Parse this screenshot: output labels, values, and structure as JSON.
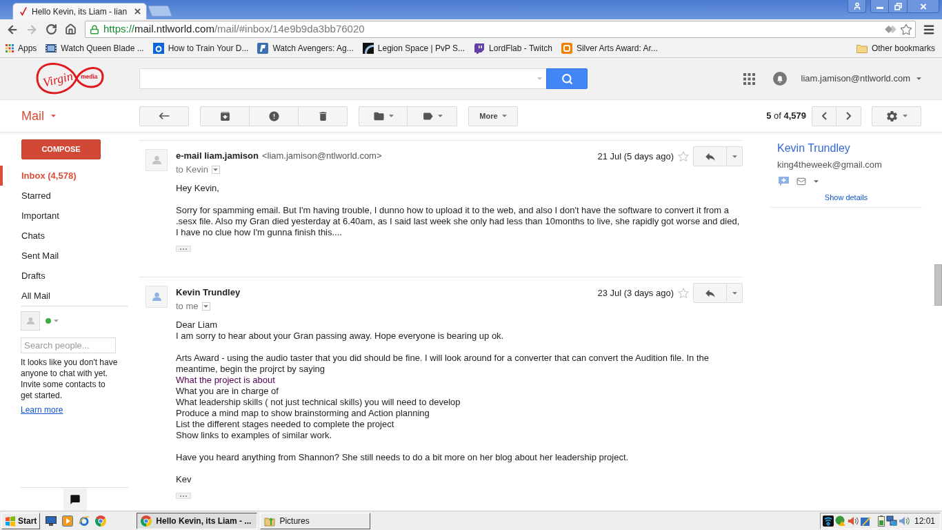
{
  "browser": {
    "tabs": [
      {
        "title": "Hello Kevin, its Liam - lian",
        "selected": true
      }
    ],
    "back": {
      "disabled": false
    },
    "forward": {
      "disabled": true
    },
    "address": {
      "secure": true,
      "scheme": "https://",
      "host": "mail.ntlworld.com",
      "path": "/mail/#inbox/14e9b9da3bb76020"
    },
    "bookmarks": [
      {
        "label": "Apps"
      },
      {
        "label": "Watch Queen Blade ..."
      },
      {
        "label": "How to Train Your D..."
      },
      {
        "label": "Watch Avengers: Ag..."
      },
      {
        "label": "Legion Space | PvP S..."
      },
      {
        "label": "LordFlab - Twitch"
      },
      {
        "label": "Silver Arts Award: Ar..."
      }
    ],
    "other_bookmarks": "Other bookmarks"
  },
  "header": {
    "logo": {
      "wordmark": "Virgin",
      "tagline": "media"
    },
    "account": "liam.jamison@ntlworld.com"
  },
  "toolbar": {
    "app": "Mail",
    "more": "More",
    "pager": "**5** of **4,579**"
  },
  "sidebar": {
    "compose": "COMPOSE",
    "folders": [
      {
        "label": "Inbox (4,578)",
        "selected": true
      },
      {
        "label": "Starred",
        "selected": false
      },
      {
        "label": "Important",
        "selected": false
      },
      {
        "label": "Chats",
        "selected": false
      },
      {
        "label": "Sent Mail",
        "selected": false
      },
      {
        "label": "Drafts",
        "selected": false
      },
      {
        "label": "All Mail",
        "selected": false
      }
    ]
  },
  "chat": {
    "online": true,
    "search_placeholder": "Search people...",
    "notice": "It looks like you don't have anyone to chat with yet. Invite some contacts to get started.",
    "link": "Learn more"
  },
  "messages": [
    {
      "sender": "e-mail liam.jamison",
      "address": "<liam.jamison@ntlworld.com>",
      "recipient": "to Kevin",
      "date": "21 Jul (5 days ago)",
      "starred": false,
      "color": "#c4c4c4",
      "paragraphs": [
        {
          "lines": [
            {
              "text": "Hey Kevin,",
              "color": "#222222"
            }
          ]
        },
        {
          "lines": [
            {
              "text": "Sorry for spamming email. But I'm having trouble, I dunno how to upload it to the web, and also I don't have the software to convert it from a .sesx file. Also my Gran died yesterday at 6.40am, as I said last week she only had less than 10months to live, she rapidly got worse and died, I have no clue how I'm gunna finish this....",
              "color": "#222222"
            }
          ]
        }
      ]
    },
    {
      "sender": "Kevin Trundley",
      "recipient": "to me",
      "date": "23 Jul (3 days ago)",
      "starred": false,
      "color": "#8fb1e6",
      "paragraphs": [
        {
          "lines": [
            {
              "text": "Dear Liam",
              "color": "#222222"
            },
            {
              "text": "I am sorry to hear about your Gran passing away. Hope everyone is bearing up ok.",
              "color": "#222222"
            }
          ]
        },
        {
          "lines": [
            {
              "text": "Arts Award - using the audio taster that you did should be fine. I will look around for a converter that can convert the Audition file. In the meantime, begin the projrct by saying",
              "color": "#222222"
            },
            {
              "text": "What the project is about",
              "color": "#500050"
            },
            {
              "text": "What you are in charge of",
              "color": "#222222"
            },
            {
              "text": "What leadership skills ( not just technical skills) you will need to develop",
              "color": "#222222"
            },
            {
              "text": "Produce a mind map to show brainstorming and Action planning",
              "color": "#222222"
            },
            {
              "text": "List the different stages needed to complete the project",
              "color": "#222222"
            },
            {
              "text": "Show links to examples of similar work.",
              "color": "#222222"
            }
          ]
        },
        {
          "lines": [
            {
              "text": "Have you heard anything from Shannon? She still needs to do a bit more on her blog about her leadership project.",
              "color": "#222222"
            }
          ]
        },
        {
          "lines": [
            {
              "text": "Kev",
              "color": "#222222"
            }
          ]
        }
      ]
    }
  ],
  "contact": {
    "name": "Kevin Trundley",
    "email": "king4theweek@gmail.com",
    "link": "Show details"
  },
  "taskbar": {
    "start": "Start",
    "tasks": [
      {
        "label": "Hello Kevin, its Liam - ...",
        "selected": true
      },
      {
        "label": "Pictures",
        "selected": false
      }
    ],
    "clock": "12:01"
  }
}
